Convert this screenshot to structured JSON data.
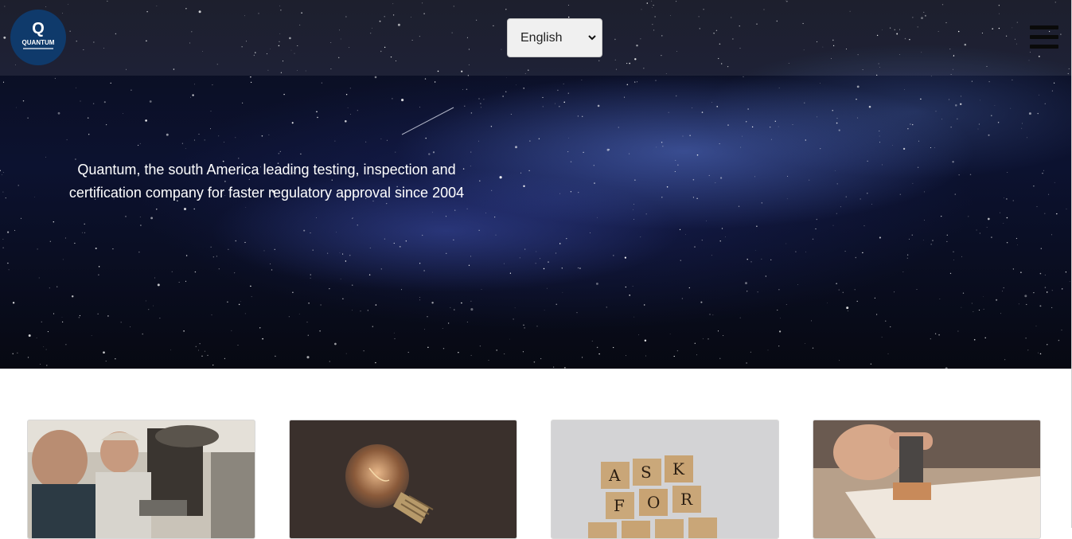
{
  "header": {
    "logo": {
      "letter": "Q",
      "name": "QUANTUM"
    },
    "language_select": {
      "selected": "English"
    },
    "menu_icon": "hamburger-menu-icon"
  },
  "hero": {
    "tagline_line1": "Quantum, the south America leading testing, inspection and",
    "tagline_line2": "certification company for faster regulatory approval since 2004"
  },
  "cards": [
    {
      "image": "workers-machinery-photo"
    },
    {
      "image": "light-bulb-photo"
    },
    {
      "image": "ask-for-help-tiles-photo",
      "tiles_row1": [
        "A",
        "S",
        "K"
      ],
      "tiles_row2": [
        "F",
        "O",
        "R"
      ]
    },
    {
      "image": "stamp-document-photo"
    }
  ],
  "colors": {
    "logo_bg": "#0f3a6b",
    "hero_dark": "#0a0d1c",
    "page_bg": "#ffffff"
  }
}
